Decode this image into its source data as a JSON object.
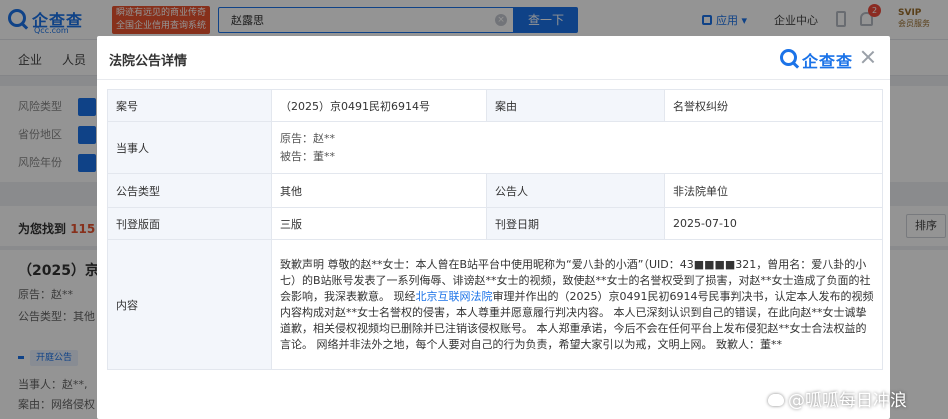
{
  "header": {
    "logo_brand": "企查查",
    "logo_domain": "Qcc.com",
    "slogan_line1": "瞬迹有远见的商业传奇",
    "slogan_line2": "全国企业信用查询系统",
    "search_value": "赵露思",
    "search_button": "查一下",
    "app_label": "应用",
    "enterprise_center": "企业中心",
    "notification_count": "2",
    "svip_title": "SVIP",
    "svip_subtitle": "会员服务"
  },
  "nav": {
    "items": [
      "企业",
      "人员"
    ]
  },
  "filters": {
    "rows": [
      "风险类型",
      "省份地区",
      "风险年份"
    ]
  },
  "results": {
    "prefix": "为您找到",
    "count": "115",
    "sort_label": "排序"
  },
  "case_card": {
    "title": "（2025）京",
    "plaintiff": "原告：赵**",
    "notice_type": "公告类型：其他",
    "tag": "开庭公告",
    "party": "当事人：赵**,",
    "cause": "案由：网络侵权"
  },
  "modal": {
    "title": "法院公告详情",
    "logo_brand": "企查查",
    "rows": {
      "case_no_label": "案号",
      "case_no_value": "（2025）京0491民初6914号",
      "cause_label": "案由",
      "cause_value": "名誉权纠纷",
      "party_label": "当事人",
      "plaintiff": "原告：赵**",
      "defendant": "被告：董**",
      "type_label": "公告类型",
      "type_value": "其他",
      "announcer_label": "公告人",
      "announcer_value": "非法院单位",
      "page_label": "刊登版面",
      "page_value": "三版",
      "date_label": "刊登日期",
      "date_value": "2025-07-10",
      "content_label": "内容",
      "content_part1": "致歉声明 尊敬的赵**女士：本人曾在B站平台中使用昵称为“爱八卦的小酒”（UID：43■■■■321，曾用名：爱八卦的小七）的B站账号发表了一系列侮辱、诽谤赵**女士的视频，致使赵**女士的名誉权受到了损害，对赵**女士造成了负面的社会影响，我深表歉意。 现经",
      "content_link": "北京互联网法院",
      "content_part2": "审理并作出的（2025）京0491民初6914号民事判决书，认定本人发布的视频内容构成对赵**女士名誉权的侵害，本人尊重并愿意履行判决内容。 本人已深刻认识到自己的错误，在此向赵**女士诚挚道歉，相关侵权视频均已删除并已注销该侵权账号。 本人郑重承诺，今后不会在任何平台上发布侵犯赵**女士合法权益的言论。 网络并非法外之地，每个人要对自己的行为负责，希望大家引以为戒，文明上网。 致歉人：董**"
    }
  },
  "watermark": "@呱呱每日冲浪"
}
